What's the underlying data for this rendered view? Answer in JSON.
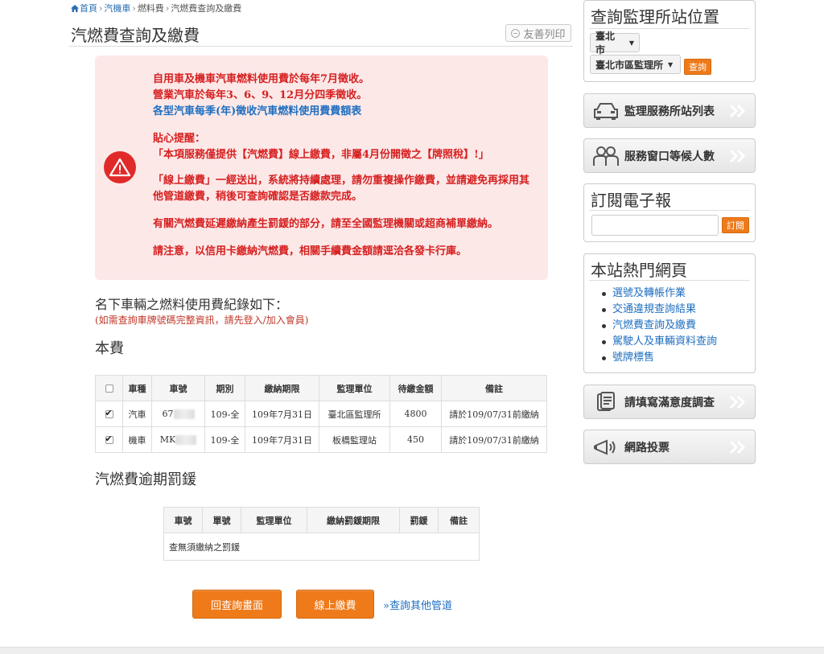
{
  "breadcrumb": {
    "home": "首頁",
    "sep": "›",
    "cat": "汽機車",
    "sub": "燃料費",
    "current": "汽燃費查詢及繳費"
  },
  "page": {
    "title": "汽燃費查詢及繳費",
    "print_label": "友善列印"
  },
  "notice": {
    "line1": "自用車及機車汽車燃料使用費於每年7月徵收。",
    "line2": "營業汽車於每年3、6、9、12月分四季徵收。",
    "link": "各型汽車每季(年)徵收汽車燃料使用費費額表",
    "tip_title": "貼心提醒：",
    "tip1": "「本項服務僅提供【汽燃費】線上繳費，非屬4月份開徵之【牌照稅】!」",
    "tip2": "「線上繳費」一經送出，系統將持續處理，請勿重複操作繳費，並請避免再採用其他管道繳費，稍後可查詢確認是否繳款完成。",
    "tip3": "有關汽燃費延遲繳納產生罰鍰的部分，請至全國監理機關或超商補單繳納。",
    "tip4": "請注意，以信用卡繳納汽燃費，相關手續費金額請逕洽各發卡行庫。"
  },
  "records": {
    "title": "名下車輛之燃料使用費紀錄如下：",
    "note": "(如需查詢車牌號碼完整資訊，請先登入/加入會員)"
  },
  "fee_section": {
    "heading": "本費",
    "headers": [
      "車種",
      "車號",
      "期別",
      "繳納期限",
      "監理單位",
      "待繳金額",
      "備註"
    ],
    "rows": [
      {
        "checked": true,
        "type": "汽車",
        "plate": "67",
        "period": "109-全",
        "deadline": "109年7月31日",
        "office": "臺北區監理所",
        "amount": "4800",
        "remark": "請於109/07/31前繳納"
      },
      {
        "checked": true,
        "type": "機車",
        "plate": "MK",
        "period": "109-全",
        "deadline": "109年7月31日",
        "office": "板橋監理站",
        "amount": "450",
        "remark": "請於109/07/31前繳納"
      }
    ]
  },
  "fine_section": {
    "heading": "汽燃費逾期罰鍰",
    "headers": [
      "車號",
      "單號",
      "監理單位",
      "繳納罰鍰期限",
      "罰鍰",
      "備註"
    ],
    "empty": "查無須繳納之罰鍰"
  },
  "actions": {
    "back": "回查詢畫面",
    "pay": "線上繳費",
    "other": "»查詢其他管道"
  },
  "sidebar": {
    "location": {
      "title": "查詢監理所站位置",
      "city": "臺北市",
      "office": "臺北市區監理所",
      "query": "查詢"
    },
    "banners": [
      {
        "label": "監理服務所站列表",
        "icon": "car-icon"
      },
      {
        "label": "服務窗口等候人數",
        "icon": "people-icon"
      }
    ],
    "subscribe": {
      "title": "訂閱電子報",
      "button": "訂閱",
      "placeholder": ""
    },
    "hot": {
      "title": "本站熱門網頁",
      "items": [
        "選號及轉帳作業",
        "交通違規查詢結果",
        "汽燃費查詢及繳費",
        "駕駛人及車輛資料查詢",
        "號牌標售"
      ]
    },
    "banners2": [
      {
        "label": "請填寫滿意度調查",
        "icon": "survey-icon"
      },
      {
        "label": "網路投票",
        "icon": "megaphone-icon"
      }
    ]
  },
  "colors": {
    "accent": "#ee7a1a",
    "link": "#1f6fc0",
    "alert": "#d62020",
    "notice_bg": "#fde8e8"
  }
}
